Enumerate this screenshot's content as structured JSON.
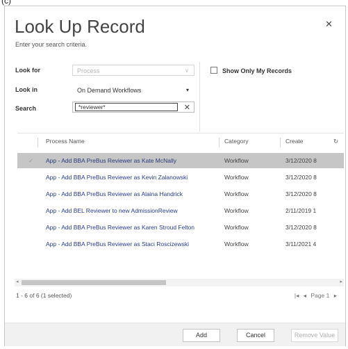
{
  "corner_label": "(c)",
  "dialog": {
    "title": "Look Up Record",
    "subtitle": "Enter your search criteria.",
    "close_icon": "close-icon"
  },
  "form": {
    "look_for_label": "Look for",
    "look_for_value": "Process",
    "look_in_label": "Look in",
    "look_in_value": "On Demand Workflows",
    "search_label": "Search",
    "search_value": "*reviewer*",
    "show_only_my_records": "Show Only My Records"
  },
  "grid": {
    "columns": [
      "Process Name",
      "Category",
      "Create"
    ],
    "rows": [
      {
        "name": "App - Add BBA PreBus Reviewer as Kate McNally",
        "category": "Workflow",
        "created": "3/12/2020 8",
        "selected": true
      },
      {
        "name": "App - Add BBA PreBus Reviewer as Kevin Zalanowski",
        "category": "Workflow",
        "created": "3/12/2020 8",
        "selected": false
      },
      {
        "name": "App - Add BBA PreBus Reviewer as Alaina Handrick",
        "category": "Workflow",
        "created": "3/12/2020 8",
        "selected": false
      },
      {
        "name": "App - Add BEL Reviewer to new AdmissionReview",
        "category": "Workflow",
        "created": "2/11/2019 1",
        "selected": false
      },
      {
        "name": "App - Add BBA PreBus Reviewer as Karen Stroud Felton",
        "category": "Workflow",
        "created": "3/12/2020 8",
        "selected": false
      },
      {
        "name": "App - Add BBA PreBus Reviewer as Staci Roscizewski",
        "category": "Workflow",
        "created": "3/11/2021 4",
        "selected": false
      }
    ],
    "status": "1 - 6 of 6 (1 selected)",
    "pager": "Page 1"
  },
  "buttons": {
    "add": "Add",
    "cancel": "Cancel",
    "remove": "Remove Value"
  },
  "colors": {
    "link": "#2a3a94",
    "selected_row": "#c6c6c6"
  }
}
